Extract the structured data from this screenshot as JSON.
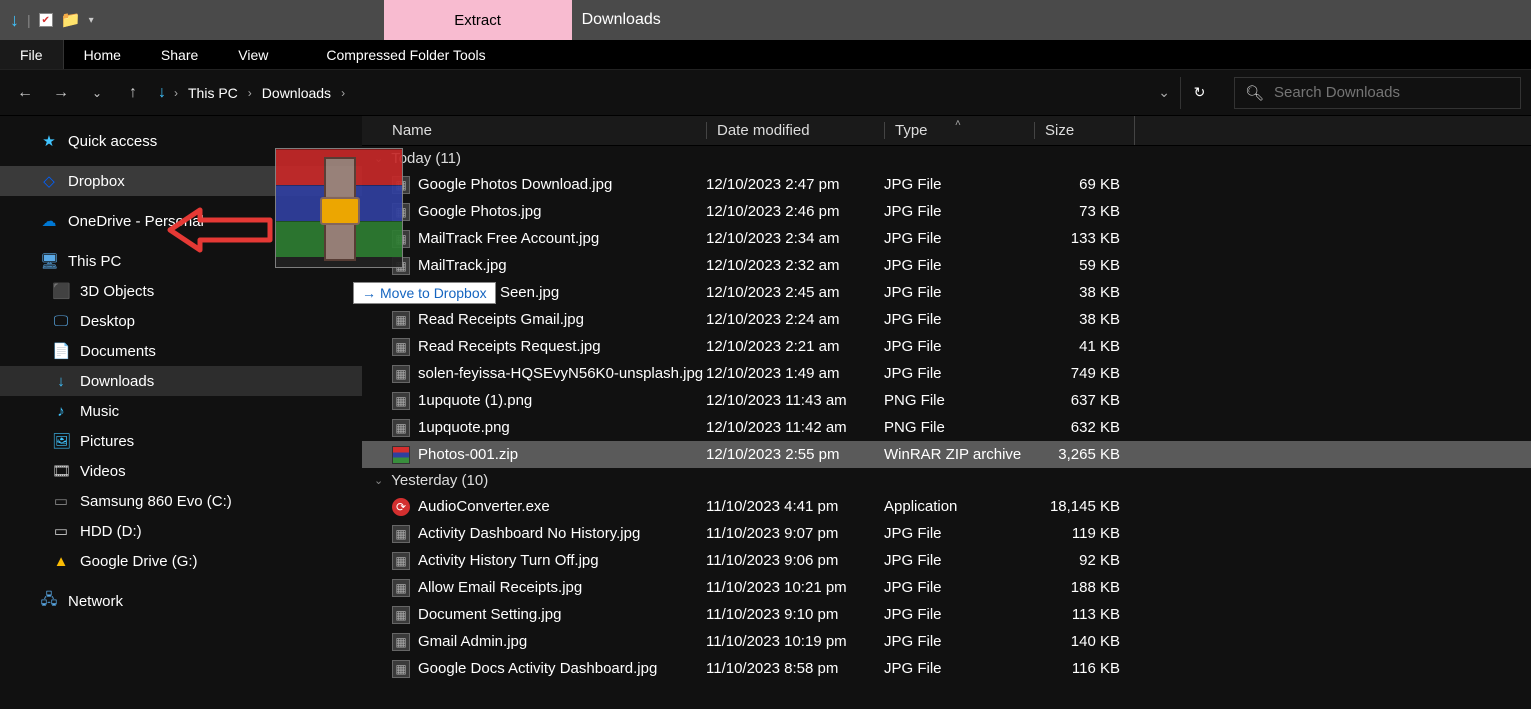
{
  "window": {
    "title": "Downloads",
    "extract_tab": "Extract"
  },
  "menu": {
    "file": "File",
    "home": "Home",
    "share": "Share",
    "view": "View",
    "cft": "Compressed Folder Tools"
  },
  "nav": {
    "crumbs": [
      "This PC",
      "Downloads"
    ],
    "search_placeholder": "Search Downloads"
  },
  "sidebar": {
    "quick": "Quick access",
    "dropbox": "Dropbox",
    "onedrive": "OneDrive - Personal",
    "thispc": "This PC",
    "items": [
      {
        "label": "3D Objects"
      },
      {
        "label": "Desktop"
      },
      {
        "label": "Documents"
      },
      {
        "label": "Downloads"
      },
      {
        "label": "Music"
      },
      {
        "label": "Pictures"
      },
      {
        "label": "Videos"
      },
      {
        "label": "Samsung 860 Evo (C:)"
      },
      {
        "label": " HDD (D:)"
      },
      {
        "label": "Google Drive (G:)"
      }
    ],
    "network": "Network"
  },
  "columns": {
    "name": "Name",
    "date": "Date modified",
    "type": "Type",
    "size": "Size"
  },
  "groups": [
    {
      "label": "Today (11)",
      "rows": [
        {
          "icon": "img",
          "name": "Google Photos Download.jpg",
          "date": "12/10/2023 2:47 pm",
          "type": "JPG File",
          "size": "69 KB"
        },
        {
          "icon": "img",
          "name": "Google Photos.jpg",
          "date": "12/10/2023 2:46 pm",
          "type": "JPG File",
          "size": "73 KB"
        },
        {
          "icon": "img",
          "name": "MailTrack Free Account.jpg",
          "date": "12/10/2023 2:34 am",
          "type": "JPG File",
          "size": "133 KB"
        },
        {
          "icon": "img",
          "name": "MailTrack.jpg",
          "date": "12/10/2023 2:32 am",
          "type": "JPG File",
          "size": "59 KB"
        },
        {
          "icon": "img",
          "name": "MailTracker Seen.jpg",
          "date": "12/10/2023 2:45 am",
          "type": "JPG File",
          "size": "38 KB"
        },
        {
          "icon": "img",
          "name": "Read Receipts Gmail.jpg",
          "date": "12/10/2023 2:24 am",
          "type": "JPG File",
          "size": "38 KB"
        },
        {
          "icon": "img",
          "name": "Read Receipts Request.jpg",
          "date": "12/10/2023 2:21 am",
          "type": "JPG File",
          "size": "41 KB"
        },
        {
          "icon": "img",
          "name": "solen-feyissa-HQSEvyN56K0-unsplash.jpg",
          "date": "12/10/2023 1:49 am",
          "type": "JPG File",
          "size": "749 KB"
        },
        {
          "icon": "img",
          "name": "1upquote (1).png",
          "date": "12/10/2023 11:43 am",
          "type": "PNG File",
          "size": "637 KB"
        },
        {
          "icon": "img",
          "name": "1upquote.png",
          "date": "12/10/2023 11:42 am",
          "type": "PNG File",
          "size": "632 KB"
        },
        {
          "icon": "zip",
          "name": "Photos-001.zip",
          "date": "12/10/2023 2:55 pm",
          "type": "WinRAR ZIP archive",
          "size": "3,265 KB",
          "selected": true
        }
      ]
    },
    {
      "label": "Yesterday (10)",
      "rows": [
        {
          "icon": "exe",
          "name": "AudioConverter.exe",
          "date": "11/10/2023 4:41 pm",
          "type": "Application",
          "size": "18,145 KB"
        },
        {
          "icon": "img",
          "name": "Activity Dashboard No History.jpg",
          "date": "11/10/2023 9:07 pm",
          "type": "JPG File",
          "size": "119 KB"
        },
        {
          "icon": "img",
          "name": "Activity History Turn Off.jpg",
          "date": "11/10/2023 9:06 pm",
          "type": "JPG File",
          "size": "92 KB"
        },
        {
          "icon": "img",
          "name": "Allow Email Receipts.jpg",
          "date": "11/10/2023 10:21 pm",
          "type": "JPG File",
          "size": "188 KB"
        },
        {
          "icon": "img",
          "name": "Document Setting.jpg",
          "date": "11/10/2023 9:10 pm",
          "type": "JPG File",
          "size": "113 KB"
        },
        {
          "icon": "img",
          "name": "Gmail Admin.jpg",
          "date": "11/10/2023 10:19 pm",
          "type": "JPG File",
          "size": "140 KB"
        },
        {
          "icon": "img",
          "name": "Google Docs Activity Dashboard.jpg",
          "date": "11/10/2023 8:58 pm",
          "type": "JPG File",
          "size": "116 KB"
        }
      ]
    }
  ],
  "drag": {
    "tooltip": "Move to Dropbox"
  }
}
